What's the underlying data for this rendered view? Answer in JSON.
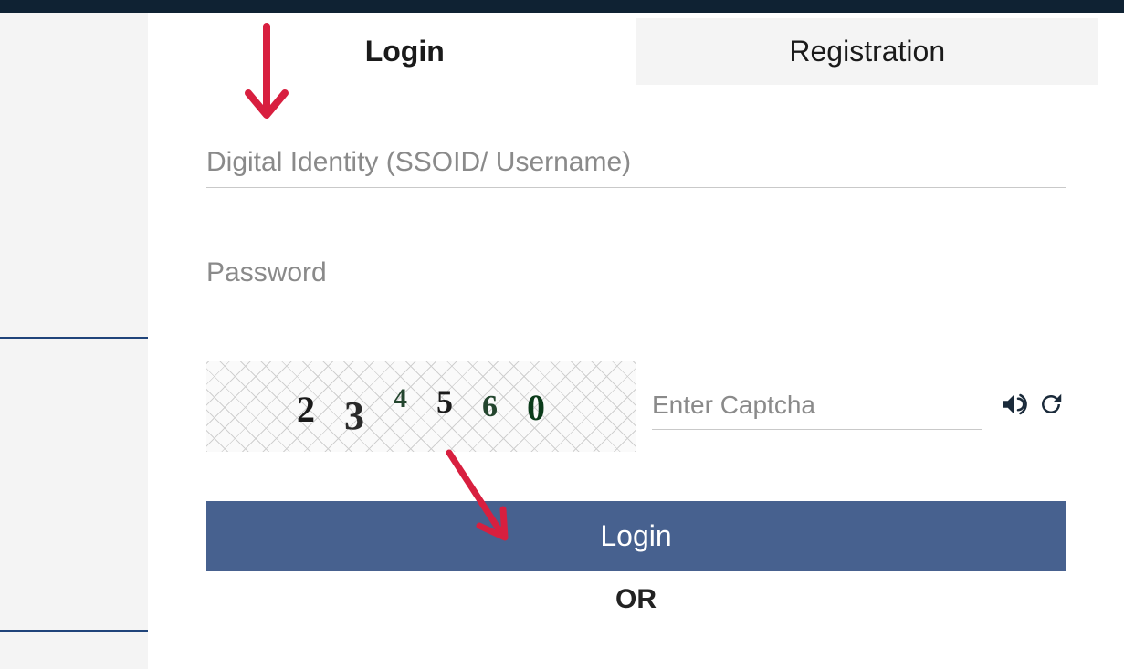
{
  "tabs": {
    "login": "Login",
    "registration": "Registration"
  },
  "fields": {
    "ssoid_placeholder": "Digital Identity (SSOID/ Username)",
    "password_placeholder": "Password",
    "captcha_placeholder": "Enter Captcha"
  },
  "captcha": {
    "d1": "2",
    "d2": "3",
    "d3": "4",
    "d4": "5",
    "d5": "6",
    "d6": "0"
  },
  "buttons": {
    "login": "Login"
  },
  "misc": {
    "or": "OR"
  }
}
